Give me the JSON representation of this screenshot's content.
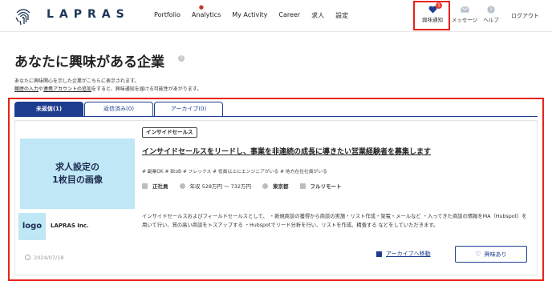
{
  "header": {
    "brand": "LAPRAS",
    "nav": [
      "Portfolio",
      "Analytics",
      "My Activity",
      "Career",
      "求人",
      "設定"
    ],
    "interest_label": "興味通知",
    "interest_badge": "1",
    "message_label": "メッセージ",
    "help_label": "ヘルプ",
    "logout_label": "ログアウト"
  },
  "page": {
    "title": "あなたに興味がある企業",
    "desc_line1": "あなたに興味関心を示した企業がこちらに表示されます。",
    "desc_link1": "職歴の入力",
    "desc_mid": "や",
    "desc_link2": "連携アカウントの追加",
    "desc_rest": "をすると、興味通知を届ける可能性があがります。"
  },
  "tabs": [
    {
      "label": "未返信(1)"
    },
    {
      "label": "返信済み(0)"
    },
    {
      "label": "アーカイブ(0)"
    }
  ],
  "card": {
    "image_line1": "求人設定の",
    "image_line2": "1枚目の画像",
    "logo_text": "logo",
    "company_name": "LAPRAS Inc.",
    "date": "2024/07/18",
    "category_tag": "インサイドセールス",
    "job_title": "インサイドセールスをリードし、事業を非連続の成長に導きたい営業経験者を募集します",
    "hashtags": "# 副業OK  # BtoB  # フレックス  # 役員以上にエンジニアがいる  # 地方在住社員がいる",
    "employment": "正社員",
    "salary": "年収 528万円 〜 732万円",
    "location": "東京都",
    "remote": "フルリモート",
    "body": "インサイドセールスおよびフィールドセールスとして、 ・新規商談の獲得から商談の実施・リスト作成・架電・メールなど ・入ってきた商談の情報をMA（Hubspot）を用いて行い、質の高い商談をトスアップする ・Hubspotでリード分析を行い、リストを作成、精査する などをしていただきます。",
    "archive_label": "アーカイブへ移動",
    "interest_button_label": "興味あり"
  },
  "colors": {
    "accent": "#1e3d8f",
    "highlight": "#e8231b",
    "image_bg": "#bfe7f6"
  }
}
